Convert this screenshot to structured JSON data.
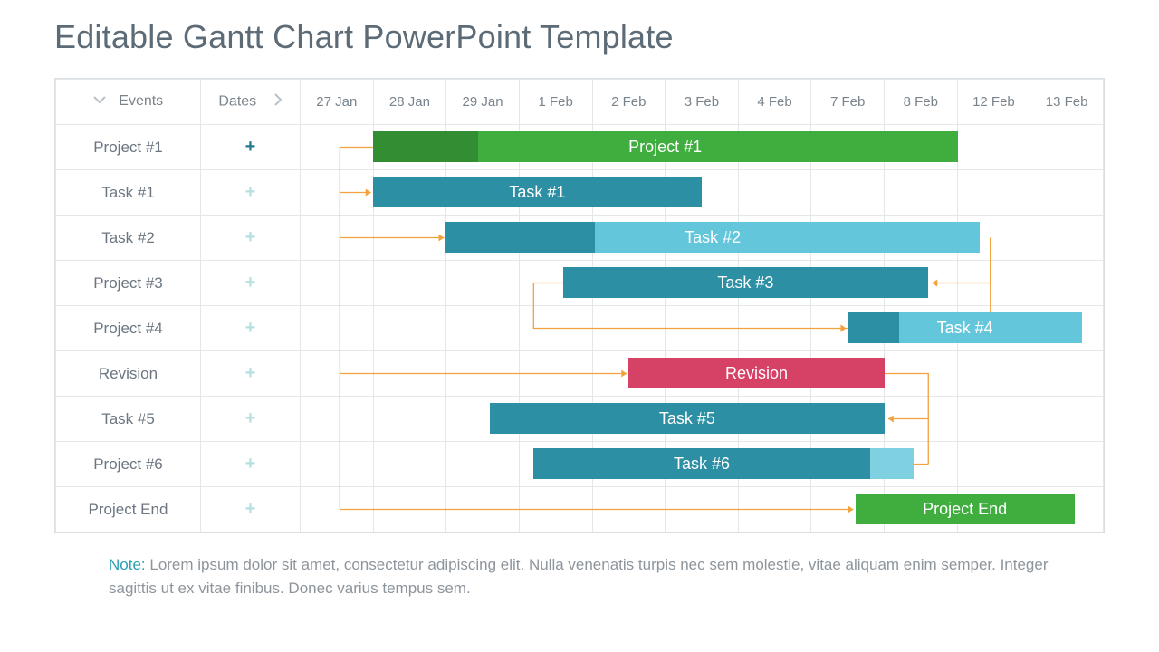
{
  "title": "Editable Gantt Chart PowerPoint Template",
  "header": {
    "events": "Events",
    "dates": "Dates"
  },
  "dates": [
    "27 Jan",
    "28 Jan",
    "29 Jan",
    "1 Feb",
    "2 Feb",
    "3 Feb",
    "4 Feb",
    "7 Feb",
    "8 Feb",
    "12 Feb",
    "13 Feb"
  ],
  "rows": [
    {
      "label": "Project #1",
      "plus": "dark"
    },
    {
      "label": "Task #1",
      "plus": "light"
    },
    {
      "label": "Task #2",
      "plus": "light"
    },
    {
      "label": "Project #3",
      "plus": "light"
    },
    {
      "label": "Project #4",
      "plus": "light"
    },
    {
      "label": "Revision",
      "plus": "light"
    },
    {
      "label": "Task #5",
      "plus": "light"
    },
    {
      "label": "Project #6",
      "plus": "light"
    },
    {
      "label": "Project End",
      "plus": "light"
    }
  ],
  "bars": [
    {
      "row": 0,
      "label": "Project #1",
      "startCol": 1,
      "span": 8,
      "color": "#3fae3f",
      "progress": 0.18
    },
    {
      "row": 1,
      "label": "Task #1",
      "startCol": 1,
      "span": 4.5,
      "color": "#2d8fa3",
      "progress": 0
    },
    {
      "row": 2,
      "label": "Task #2",
      "startCol": 2,
      "span": 7.3,
      "color": "#63c6db",
      "progress": 0.28,
      "progColor": "#2d8fa3"
    },
    {
      "row": 3,
      "label": "Task #3",
      "startCol": 3.6,
      "span": 5,
      "color": "#2d8fa3",
      "progress": 0
    },
    {
      "row": 4,
      "label": "Task #4",
      "startCol": 7.5,
      "span": 3.2,
      "color": "#63c6db",
      "progress": 0.22,
      "progColor": "#2d8fa3"
    },
    {
      "row": 5,
      "label": "Revision",
      "startCol": 4.5,
      "span": 3.5,
      "color": "#d64265",
      "progress": 0
    },
    {
      "row": 6,
      "label": "Task #5",
      "startCol": 2.6,
      "span": 5.4,
      "color": "#2d8fa3",
      "progress": 0
    },
    {
      "row": 7,
      "label": "Task #6",
      "startCol": 3.2,
      "span": 4.6,
      "color": "#2d8fa3",
      "progress": 0,
      "tail": 0.6,
      "tailColor": "#7fd0e0"
    },
    {
      "row": 8,
      "label": "Project End",
      "startCol": 7.6,
      "span": 3,
      "color": "#3fae3f",
      "progress": 0
    }
  ],
  "note": {
    "label": "Note:",
    "text": " Lorem ipsum dolor sit amet, consectetur adipiscing elit. Nulla venenatis turpis nec sem molestie, vitae aliquam enim semper. Integer sagittis ut ex vitae finibus. Donec varius tempus sem."
  },
  "chart_data": {
    "type": "gantt",
    "title": "Editable Gantt Chart PowerPoint Template",
    "x_categories": [
      "27 Jan",
      "28 Jan",
      "29 Jan",
      "1 Feb",
      "2 Feb",
      "3 Feb",
      "4 Feb",
      "7 Feb",
      "8 Feb",
      "12 Feb",
      "13 Feb"
    ],
    "tasks": [
      {
        "name": "Project #1",
        "start": "28 Jan",
        "end": "8 Feb",
        "color": "green",
        "progress_pct": 18
      },
      {
        "name": "Task #1",
        "start": "28 Jan",
        "end": "3 Feb",
        "color": "teal",
        "progress_pct": 0
      },
      {
        "name": "Task #2",
        "start": "29 Jan",
        "end": "12 Feb",
        "color": "lightblue",
        "progress_pct": 28
      },
      {
        "name": "Task #3",
        "start": "1 Feb",
        "end": "8 Feb",
        "color": "teal",
        "progress_pct": 0
      },
      {
        "name": "Task #4",
        "start": "7 Feb",
        "end": "13 Feb",
        "color": "lightblue",
        "progress_pct": 22
      },
      {
        "name": "Revision",
        "start": "2 Feb",
        "end": "7 Feb",
        "color": "pink",
        "progress_pct": 0
      },
      {
        "name": "Task #5",
        "start": "29 Jan",
        "end": "7 Feb",
        "color": "teal",
        "progress_pct": 0
      },
      {
        "name": "Task #6",
        "start": "1 Feb",
        "end": "7 Feb",
        "color": "teal",
        "progress_pct": 0
      },
      {
        "name": "Project End",
        "start": "7 Feb",
        "end": "13 Feb",
        "color": "green",
        "progress_pct": 0
      }
    ],
    "dependencies": [
      [
        "Project #1",
        "Task #1"
      ],
      [
        "Project #1",
        "Task #2"
      ],
      [
        "Task #2",
        "Task #3"
      ],
      [
        "Task #2",
        "Task #4"
      ],
      [
        "Project #1",
        "Revision"
      ],
      [
        "Revision",
        "Task #5"
      ],
      [
        "Revision",
        "Task #6"
      ],
      [
        "Project #1",
        "Project End"
      ]
    ]
  }
}
